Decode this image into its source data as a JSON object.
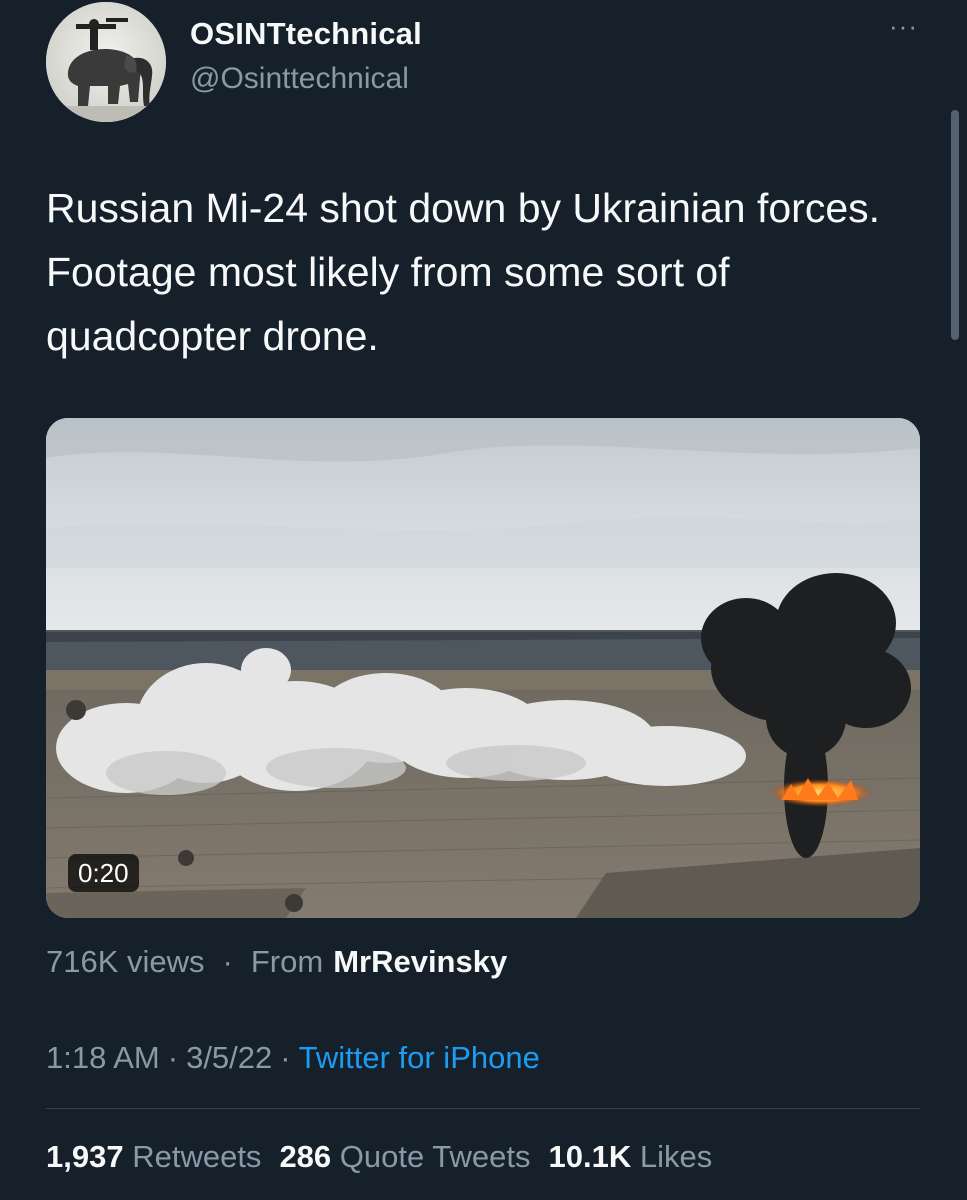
{
  "tweet": {
    "author": {
      "display_name": "OSINTtechnical",
      "handle": "@Osinttechnical"
    },
    "more_menu_glyph": "···",
    "text": "Russian Mi-24 shot down by Ukrainian forces. Footage most likely from some sort of quadcopter drone.",
    "media": {
      "type": "video",
      "duration": "0:20"
    },
    "views": "716K views",
    "separator": "·",
    "from_label": "From",
    "from_source": "MrRevinsky",
    "time": "1:18 AM",
    "date": "3/5/22",
    "client": "Twitter for iPhone",
    "stats": {
      "retweets_count": "1,937",
      "retweets_label": "Retweets",
      "quotes_count": "286",
      "quotes_label": "Quote Tweets",
      "likes_count": "10.1K",
      "likes_label": "Likes"
    }
  },
  "colors": {
    "background": "#15202b",
    "primary_text": "#f7f9f9",
    "secondary_text": "#8b98a5",
    "accent": "#1d9bf0",
    "divider": "#38444d"
  },
  "icons": {
    "more": "more-horizontal-icon",
    "avatar": "avatar-elephant-image"
  }
}
